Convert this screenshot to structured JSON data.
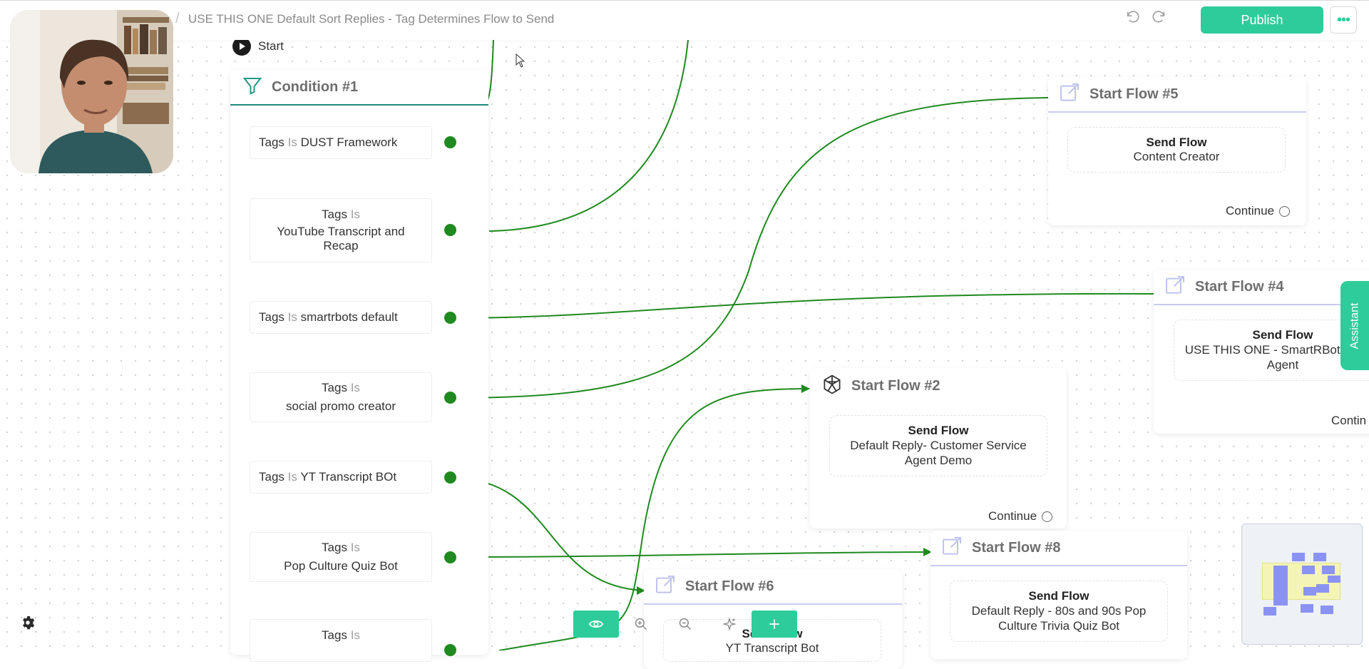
{
  "header": {
    "breadcrumb_sep": "/",
    "flow_title": "USE THIS ONE Default Sort Replies - Tag Determines Flow to Send",
    "publish_label": "Publish",
    "more_label": "•••",
    "accent_color": "#2ecc9a"
  },
  "start": {
    "label": "Start"
  },
  "condition": {
    "title": "Condition #1",
    "rows": [
      {
        "field": "Tags",
        "op": "Is",
        "value": "DUST Framework"
      },
      {
        "field": "Tags",
        "op": "Is",
        "value": "YouTube Transcript and Recap"
      },
      {
        "field": "Tags",
        "op": "Is",
        "value": "smartrbots default"
      },
      {
        "field": "Tags",
        "op": "Is",
        "value": "social promo creator"
      },
      {
        "field": "Tags",
        "op": "Is",
        "value": "YT Transcript BOt"
      },
      {
        "field": "Tags",
        "op": "Is",
        "value": "Pop Culture Quiz Bot"
      },
      {
        "field": "Tags",
        "op": "Is"
      }
    ]
  },
  "flows": {
    "f5": {
      "title": "Start Flow #5",
      "action": "Send Flow",
      "target": "Content Creator",
      "continue": "Continue",
      "icon": "external-link-icon"
    },
    "f4": {
      "title": "Start Flow #4",
      "action": "Send Flow",
      "target": "USE THIS ONE - SmartRBots Reply Agent",
      "continue": "Contin",
      "icon": "external-link-icon"
    },
    "f2": {
      "title": "Start Flow #2",
      "action": "Send Flow",
      "target": "Default Reply- Customer Service Agent Demo",
      "continue": "Continue",
      "icon": "openai-logo-icon"
    },
    "f8": {
      "title": "Start Flow #8",
      "action": "Send Flow",
      "target": "Default Reply - 80s and 90s Pop Culture Trivia Quiz Bot",
      "icon": "external-link-icon"
    },
    "f6": {
      "title": "Start Flow #6",
      "action": "Send Flow",
      "target": "YT Transcript Bot",
      "icon": "external-link-icon"
    }
  },
  "assistant": {
    "label": "Assistant"
  },
  "connector_color": "#1f8a1f"
}
